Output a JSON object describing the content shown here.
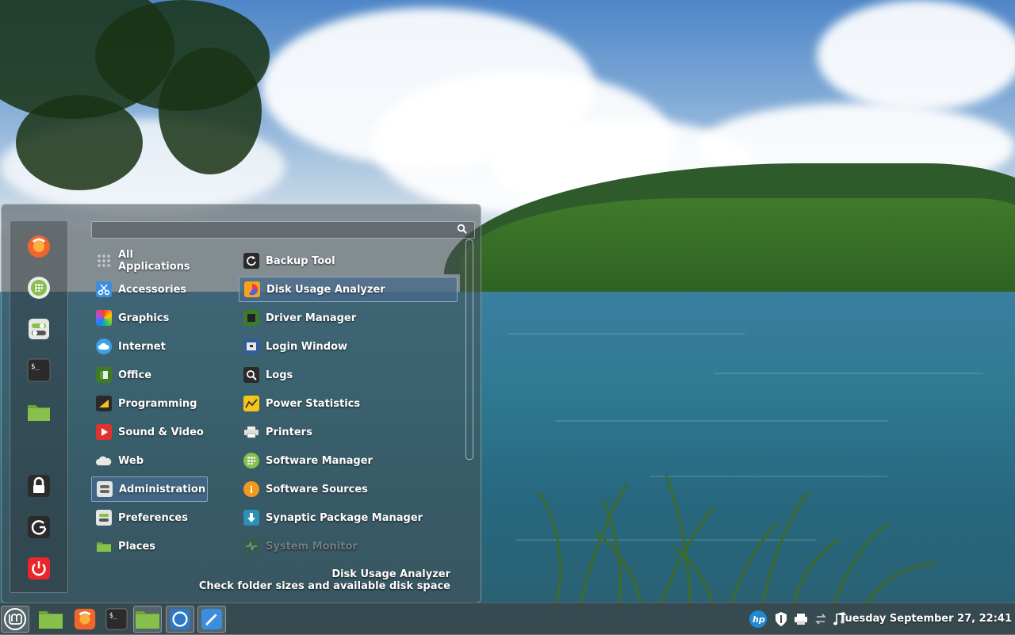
{
  "colors": {
    "mint_green": "#87c04a",
    "selection": "#466a8c",
    "panel": "#3c4244",
    "firefox_orange": "#f0652c",
    "power_red": "#e8262c"
  },
  "menu": {
    "search": {
      "value": "",
      "placeholder": ""
    },
    "favorites": [
      {
        "name": "firefox-icon"
      },
      {
        "name": "software-manager-icon"
      },
      {
        "name": "system-settings-icon"
      },
      {
        "name": "terminal-icon"
      },
      {
        "name": "files-icon"
      }
    ],
    "session": [
      {
        "name": "lock-screen-icon"
      },
      {
        "name": "logout-icon"
      },
      {
        "name": "shutdown-icon"
      }
    ],
    "categories": [
      {
        "label": "All Applications",
        "icon": "grid-icon"
      },
      {
        "label": "Accessories",
        "icon": "accessories-icon"
      },
      {
        "label": "Graphics",
        "icon": "graphics-icon"
      },
      {
        "label": "Internet",
        "icon": "internet-icon"
      },
      {
        "label": "Office",
        "icon": "office-icon"
      },
      {
        "label": "Programming",
        "icon": "programming-icon"
      },
      {
        "label": "Sound & Video",
        "icon": "multimedia-icon"
      },
      {
        "label": "Web",
        "icon": "web-icon"
      },
      {
        "label": "Administration",
        "icon": "administration-icon",
        "selected": true
      },
      {
        "label": "Preferences",
        "icon": "preferences-icon"
      },
      {
        "label": "Places",
        "icon": "folder-icon"
      }
    ],
    "apps": [
      {
        "label": "Backup Tool",
        "icon": "backup-icon"
      },
      {
        "label": "Disk Usage Analyzer",
        "icon": "disk-usage-icon",
        "selected": true
      },
      {
        "label": "Driver Manager",
        "icon": "driver-icon"
      },
      {
        "label": "Login Window",
        "icon": "login-window-icon"
      },
      {
        "label": "Logs",
        "icon": "logs-icon"
      },
      {
        "label": "Power Statistics",
        "icon": "power-statistics-icon"
      },
      {
        "label": "Printers",
        "icon": "printer-icon"
      },
      {
        "label": "Software Manager",
        "icon": "software-manager-icon"
      },
      {
        "label": "Software Sources",
        "icon": "software-sources-icon"
      },
      {
        "label": "Synaptic Package Manager",
        "icon": "synaptic-icon"
      },
      {
        "label": "System Monitor",
        "icon": "system-monitor-icon",
        "dimmed": true
      }
    ],
    "description": {
      "title": "Disk Usage Analyzer",
      "text": "Check folder sizes and available disk space"
    }
  },
  "panel": {
    "launchers": [
      {
        "name": "mint-menu-icon"
      },
      {
        "name": "files-icon"
      },
      {
        "name": "firefox-icon"
      },
      {
        "name": "terminal-icon"
      },
      {
        "name": "files-window-icon"
      },
      {
        "name": "browser-window-icon"
      },
      {
        "name": "text-editor-window-icon"
      }
    ],
    "tray": [
      {
        "name": "hp-icon"
      },
      {
        "name": "shield-icon"
      },
      {
        "name": "printer-icon"
      },
      {
        "name": "network-icon"
      },
      {
        "name": "music-icon"
      }
    ],
    "clock": "Tuesday September 27, 22:41"
  }
}
